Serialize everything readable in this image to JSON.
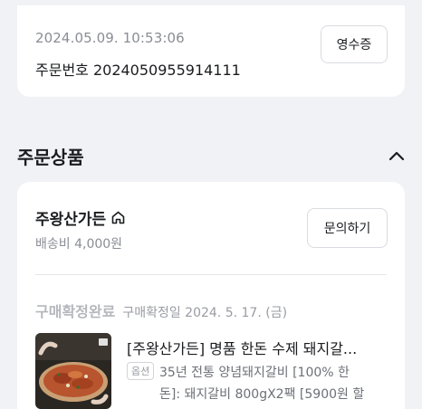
{
  "order": {
    "datetime": "2024.05.09. 10:53:06",
    "number": "주문번호 2024050955914111",
    "receipt_label": "영수증"
  },
  "section": {
    "title": "주문상품"
  },
  "store": {
    "name": "주왕산가든",
    "shipping": "배송비 4,000원",
    "inquiry_label": "문의하기"
  },
  "item": {
    "status": "구매확정완료",
    "confirm_date": "구매확정일 2024. 5. 17. (금)",
    "title": "[주왕산가든] 명품 한돈 수제 돼지갈...",
    "option_badge": "옵션",
    "option_line1": "35년 전통 양념돼지갈비 [100% 한",
    "option_line2": "돈]: 돼지갈비 800gX2팩 [5900원 할"
  },
  "colors": {
    "background": "#f1f2f5",
    "card": "#ffffff",
    "muted_text": "#8a8d94"
  },
  "icons": {
    "collapse": "chevron-up-icon",
    "store_home": "home-icon"
  }
}
